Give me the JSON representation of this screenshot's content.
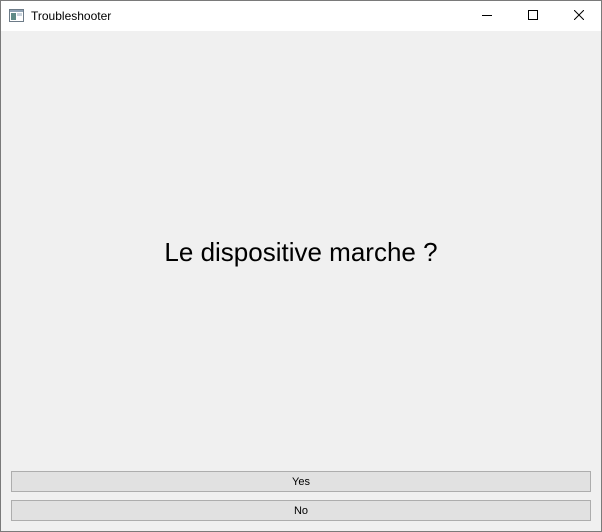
{
  "window": {
    "title": "Troubleshooter",
    "icon": "application-window-icon",
    "controls": [
      "minimize-icon",
      "maximize-icon",
      "close-icon"
    ]
  },
  "main": {
    "question": "Le dispositive marche ?"
  },
  "buttons": {
    "yes_label": "Yes",
    "no_label": "No"
  },
  "colors": {
    "titlebar_bg": "#ffffff",
    "content_bg": "#f0f0f0",
    "button_bg": "#e1e1e1",
    "button_border": "#adadad"
  }
}
